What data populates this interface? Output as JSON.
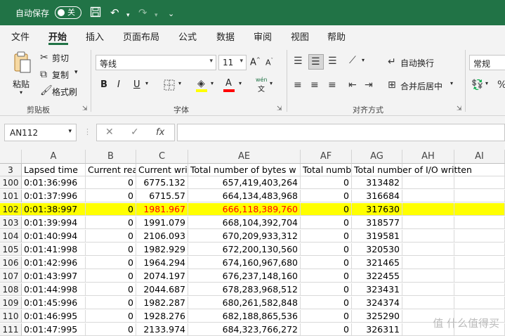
{
  "titlebar": {
    "autosave_label": "自动保存",
    "autosave_state": "关"
  },
  "tabs": [
    "文件",
    "开始",
    "插入",
    "页面布局",
    "公式",
    "数据",
    "审阅",
    "视图",
    "帮助"
  ],
  "ribbon": {
    "clipboard": {
      "paste": "粘贴",
      "cut": "剪切",
      "copy": "复制",
      "format_painter": "格式刷",
      "label": "剪贴板"
    },
    "font": {
      "name": "等线",
      "size": "11",
      "label": "字体",
      "bold": "B",
      "italic": "I",
      "underline": "U",
      "phonetic": "wén"
    },
    "alignment": {
      "wrap": "自动换行",
      "merge": "合并后居中",
      "label": "对齐方式"
    },
    "number": {
      "format": "常规"
    }
  },
  "formula_bar": {
    "name_box": "AN112",
    "fx": "fx",
    "value": ""
  },
  "columns": [
    {
      "id": "A",
      "label": "A"
    },
    {
      "id": "B",
      "label": "B"
    },
    {
      "id": "C",
      "label": "C"
    },
    {
      "id": "AE",
      "label": "AE"
    },
    {
      "id": "AF",
      "label": "AF"
    },
    {
      "id": "AG",
      "label": "AG"
    },
    {
      "id": "AH",
      "label": "AH"
    },
    {
      "id": "AI",
      "label": "AI"
    }
  ],
  "header_row": {
    "row": "3",
    "cells": [
      "Lapsed time",
      "Current rea",
      "Current wri",
      "Total number of bytes w",
      "Total numb",
      "Total number of I/O written",
      "",
      ""
    ]
  },
  "rows": [
    {
      "row": "100",
      "cells": [
        "0:01:36:996",
        "0",
        "6775.132",
        "657,419,403,264",
        "0",
        "313482",
        "",
        ""
      ],
      "highlight": false
    },
    {
      "row": "101",
      "cells": [
        "0:01:37:996",
        "0",
        "6715.57",
        "664,134,483,968",
        "0",
        "316684",
        "",
        ""
      ],
      "highlight": false
    },
    {
      "row": "102",
      "cells": [
        "0:01:38:997",
        "0",
        "1981.967",
        "666,118,389,760",
        "0",
        "317630",
        "",
        ""
      ],
      "highlight": true
    },
    {
      "row": "103",
      "cells": [
        "0:01:39:994",
        "0",
        "1991.079",
        "668,104,392,704",
        "0",
        "318577",
        "",
        ""
      ],
      "highlight": false
    },
    {
      "row": "104",
      "cells": [
        "0:01:40:994",
        "0",
        "2106.093",
        "670,209,933,312",
        "0",
        "319581",
        "",
        ""
      ],
      "highlight": false
    },
    {
      "row": "105",
      "cells": [
        "0:01:41:998",
        "0",
        "1982.929",
        "672,200,130,560",
        "0",
        "320530",
        "",
        ""
      ],
      "highlight": false
    },
    {
      "row": "106",
      "cells": [
        "0:01:42:996",
        "0",
        "1964.294",
        "674,160,967,680",
        "0",
        "321465",
        "",
        ""
      ],
      "highlight": false
    },
    {
      "row": "107",
      "cells": [
        "0:01:43:997",
        "0",
        "2074.197",
        "676,237,148,160",
        "0",
        "322455",
        "",
        ""
      ],
      "highlight": false
    },
    {
      "row": "108",
      "cells": [
        "0:01:44:998",
        "0",
        "2044.687",
        "678,283,968,512",
        "0",
        "323431",
        "",
        ""
      ],
      "highlight": false
    },
    {
      "row": "109",
      "cells": [
        "0:01:45:996",
        "0",
        "1982.287",
        "680,261,582,848",
        "0",
        "324374",
        "",
        ""
      ],
      "highlight": false
    },
    {
      "row": "110",
      "cells": [
        "0:01:46:995",
        "0",
        "1928.276",
        "682,188,865,536",
        "0",
        "325290",
        "",
        ""
      ],
      "highlight": false
    },
    {
      "row": "111",
      "cells": [
        "0:01:47:995",
        "0",
        "2133.974",
        "684,323,766,272",
        "0",
        "326311",
        "",
        ""
      ],
      "highlight": false
    }
  ],
  "watermark": "值 什么值得买"
}
